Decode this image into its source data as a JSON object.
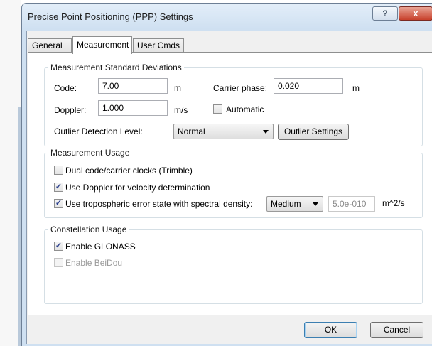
{
  "window": {
    "title": "Precise Point Positioning (PPP) Settings",
    "help_glyph": "?",
    "close_glyph": "x"
  },
  "tabs": [
    {
      "label": "General",
      "active": false
    },
    {
      "label": "Measurement",
      "active": true
    },
    {
      "label": "User Cmds",
      "active": false
    }
  ],
  "std_dev": {
    "group_label": "Measurement Standard Deviations",
    "code_label": "Code:",
    "code_value": "7.00",
    "code_unit": "m",
    "carrier_label": "Carrier phase:",
    "carrier_value": "0.020",
    "carrier_unit": "m",
    "doppler_label": "Doppler:",
    "doppler_value": "1.000",
    "doppler_unit": "m/s",
    "automatic_label": "Automatic",
    "automatic_checked": false,
    "outlier_label": "Outlier Detection Level:",
    "outlier_value": "Normal",
    "outlier_settings_button": "Outlier Settings"
  },
  "usage": {
    "group_label": "Measurement Usage",
    "items": [
      {
        "label": "Dual code/carrier clocks (Trimble)",
        "checked": false
      },
      {
        "label": "Use Doppler for velocity determination",
        "checked": true
      },
      {
        "label": "Use tropospheric error state with spectral density:",
        "checked": true
      }
    ],
    "tropo_level": "Medium",
    "tropo_value": "5.0e-010",
    "tropo_unit": "m^2/s"
  },
  "constellation": {
    "group_label": "Constellation Usage",
    "glonass_label": "Enable GLONASS",
    "glonass_checked": true,
    "beidou_label": "Enable BeiDou",
    "beidou_checked": false
  },
  "footer": {
    "ok_label": "OK",
    "cancel_label": "Cancel"
  },
  "check_glyph": "✓"
}
